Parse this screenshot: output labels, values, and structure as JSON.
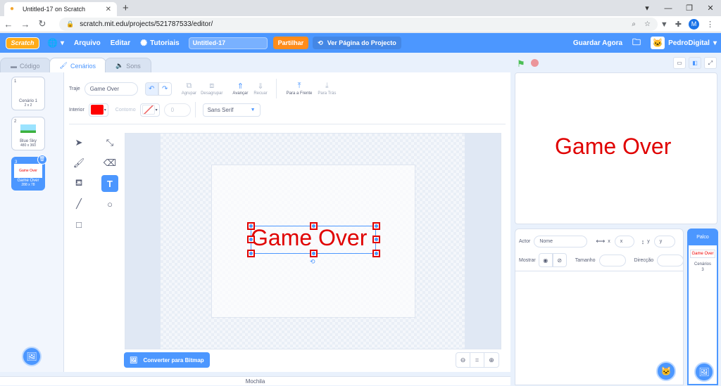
{
  "browser": {
    "tab_title": "Untitled-17 on Scratch",
    "url": "scratch.mit.edu/projects/521787533/editor/",
    "profile_initial": "M"
  },
  "menu": {
    "logo": "Scratch",
    "file": "Arquivo",
    "edit": "Editar",
    "tutorials": "Tutoriais",
    "project_title": "Untitled-17",
    "share": "Partilhar",
    "see_project": "Ver Página do Projecto",
    "save_now": "Guardar Agora",
    "username": "PedroDigital"
  },
  "tabs": {
    "code": "Código",
    "costumes": "Cenários",
    "sounds": "Sons"
  },
  "costumes": [
    {
      "num": "1",
      "name": "Cenário 1",
      "size": "2 x 2"
    },
    {
      "num": "2",
      "name": "Blue Sky",
      "size": "480 x 360"
    },
    {
      "num": "3",
      "name": "Game Over",
      "size": "288 x 78",
      "thumb_text": "Game Over"
    }
  ],
  "paint": {
    "costume_label": "Traje",
    "costume_name": "Game Over",
    "group": "Agrupar",
    "ungroup": "Desagrupar",
    "forward": "Avançar",
    "backward": "Recuar",
    "front": "Para a Frente",
    "back": "Para Trás",
    "fill_label": "Interior",
    "outline_label": "Contorno",
    "outline_width": "0",
    "font": "Sans Serif",
    "fill_color": "#ff0000",
    "canvas_text": "Game Over",
    "convert_bitmap": "Converter para Bitmap",
    "zoom_reset": "="
  },
  "backpack": "Mochila",
  "stage": {
    "text": "Game Over"
  },
  "sprite_info": {
    "sprite_label": "Actor",
    "name_placeholder": "Nome",
    "x_label": "x",
    "x_placeholder": "x",
    "y_label": "y",
    "y_placeholder": "y",
    "show_label": "Mostrar",
    "size_label": "Tamanho",
    "direction_label": "Direcção"
  },
  "stage_panel": {
    "title": "Palco",
    "mini_text": "Game Over",
    "backdrops_label": "Cenários",
    "backdrops_count": "3"
  }
}
